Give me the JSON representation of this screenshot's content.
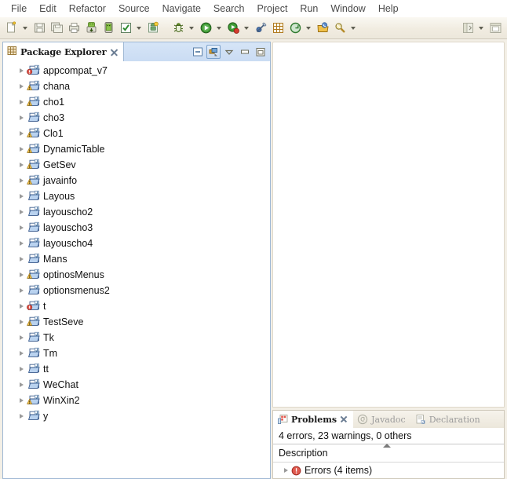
{
  "menubar": {
    "items": [
      {
        "label": "File"
      },
      {
        "label": "Edit"
      },
      {
        "label": "Refactor"
      },
      {
        "label": "Source"
      },
      {
        "label": "Navigate"
      },
      {
        "label": "Search"
      },
      {
        "label": "Project"
      },
      {
        "label": "Run"
      },
      {
        "label": "Window"
      },
      {
        "label": "Help"
      }
    ]
  },
  "toolbar": {
    "buttons": [
      {
        "name": "new-icon",
        "kind": "new",
        "has_arrow": true
      },
      {
        "name": "save-icon",
        "kind": "save",
        "has_arrow": false
      },
      {
        "name": "save-all-icon",
        "kind": "save-all",
        "has_arrow": false
      },
      {
        "name": "print-icon",
        "kind": "print",
        "has_arrow": false
      },
      {
        "name": "android-sdk-manager-icon",
        "kind": "sdk",
        "has_arrow": false
      },
      {
        "name": "android-virtual-device-manager-icon",
        "kind": "avd",
        "has_arrow": false
      },
      {
        "name": "build-check-icon",
        "kind": "check",
        "has_arrow": true
      },
      {
        "name": "new-android-project-icon",
        "kind": "android-new",
        "has_arrow": false
      },
      {
        "name": "debug-icon",
        "kind": "debug",
        "has_arrow": true
      },
      {
        "name": "run-icon",
        "kind": "run",
        "has_arrow": true
      },
      {
        "name": "run-coverage-icon",
        "kind": "coverage",
        "has_arrow": true
      },
      {
        "name": "skip-breakpoints-icon",
        "kind": "skip-bp",
        "has_arrow": false
      },
      {
        "name": "new-java-package-icon",
        "kind": "package",
        "has_arrow": false
      },
      {
        "name": "new-java-class-icon",
        "kind": "class",
        "has_arrow": true
      },
      {
        "name": "open-type-icon",
        "kind": "opentype",
        "has_arrow": false
      },
      {
        "name": "search-icon",
        "kind": "search",
        "has_arrow": true
      }
    ],
    "right_buttons": [
      {
        "name": "java-perspective-icon",
        "kind": "perspective",
        "has_arrow": true
      },
      {
        "name": "open-perspective-icon",
        "kind": "open-persp",
        "has_arrow": false
      }
    ]
  },
  "package_explorer": {
    "title": "Package Explorer",
    "toolbar": [
      {
        "name": "collapse-all-icon",
        "label": "Collapse All",
        "active": false
      },
      {
        "name": "link-with-editor-icon",
        "label": "Link with Editor",
        "active": true
      },
      {
        "name": "view-menu-icon",
        "label": "View Menu",
        "active": false
      },
      {
        "name": "minimize-icon",
        "label": "Minimize",
        "active": false
      },
      {
        "name": "maximize-icon",
        "label": "Maximize",
        "active": false
      }
    ],
    "projects": [
      {
        "label": "appcompat_v7",
        "badge": "error"
      },
      {
        "label": "chana",
        "badge": "warning"
      },
      {
        "label": "cho1",
        "badge": "warning"
      },
      {
        "label": "cho3",
        "badge": "none"
      },
      {
        "label": "Clo1",
        "badge": "warning"
      },
      {
        "label": "DynamicTable",
        "badge": "warning"
      },
      {
        "label": "GetSev",
        "badge": "warning"
      },
      {
        "label": "javainfo",
        "badge": "warning"
      },
      {
        "label": "Layous",
        "badge": "none"
      },
      {
        "label": "layouscho2",
        "badge": "none"
      },
      {
        "label": "layouscho3",
        "badge": "none"
      },
      {
        "label": "layouscho4",
        "badge": "none"
      },
      {
        "label": "Mans",
        "badge": "none"
      },
      {
        "label": "optinosMenus",
        "badge": "warning"
      },
      {
        "label": "optionsmenus2",
        "badge": "none"
      },
      {
        "label": "t",
        "badge": "error"
      },
      {
        "label": "TestSeve",
        "badge": "warning"
      },
      {
        "label": "Tk",
        "badge": "none"
      },
      {
        "label": "Tm",
        "badge": "none"
      },
      {
        "label": "tt",
        "badge": "none"
      },
      {
        "label": "WeChat",
        "badge": "none"
      },
      {
        "label": "WinXin2",
        "badge": "warning"
      },
      {
        "label": "y",
        "badge": "none"
      }
    ]
  },
  "bottom_panel": {
    "tabs": [
      {
        "label": "Problems",
        "icon": "problems-icon",
        "active": true,
        "closable": true
      },
      {
        "label": "Javadoc",
        "icon": "javadoc-icon",
        "active": false,
        "closable": false
      },
      {
        "label": "Declaration",
        "icon": "declaration-icon",
        "active": false,
        "closable": false
      }
    ],
    "summary": "4 errors, 23 warnings, 0 others",
    "column_header": "Description",
    "rows": [
      {
        "label": "Errors (4 items)",
        "icon": "error-icon"
      }
    ]
  },
  "colors": {
    "toolbar_bg": "#f1ece1",
    "tab_active_bg": "#ffffff",
    "tab_selected_border": "#9fb8d4",
    "error_red": "#d0342c",
    "warning_yellow": "#e8b233",
    "editor_bg": "#ffffff"
  }
}
